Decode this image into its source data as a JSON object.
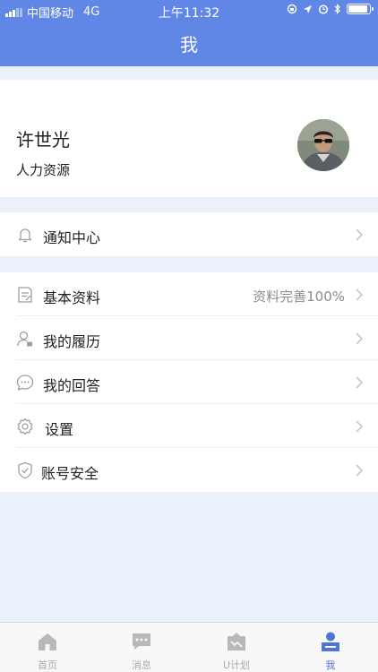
{
  "status_bar": {
    "carrier": "中国移动",
    "network": "4G",
    "time": "上午11:32",
    "battery_level": 0.9
  },
  "header": {
    "title": "我"
  },
  "profile": {
    "name": "许世光",
    "department": "人力资源",
    "avatar_icon": "user-avatar-photo"
  },
  "notifications": {
    "label": "通知中心",
    "icon": "bell-icon"
  },
  "menu": {
    "items": [
      {
        "label": "基本资料",
        "value": "资料完善100%",
        "icon": "document-edit-icon"
      },
      {
        "label": "我的履历",
        "value": "",
        "icon": "user-resume-icon"
      },
      {
        "label": "我的回答",
        "value": "",
        "icon": "chat-bubble-icon"
      },
      {
        "label": "设置",
        "value": "",
        "icon": "gear-icon"
      },
      {
        "label": "账号安全",
        "value": "",
        "icon": "shield-icon"
      }
    ]
  },
  "tabbar": {
    "tabs": [
      {
        "label": "首页",
        "icon": "home-icon"
      },
      {
        "label": "消息",
        "icon": "message-icon"
      },
      {
        "label": "U计划",
        "icon": "plan-icon"
      },
      {
        "label": "我",
        "icon": "profile-icon"
      }
    ],
    "active_index": 3
  },
  "colors": {
    "header_bg": "#6187e6",
    "page_bg": "#ebf1fb",
    "active_tab": "#4d74d6",
    "inactive_tab": "#a9a9a9"
  }
}
